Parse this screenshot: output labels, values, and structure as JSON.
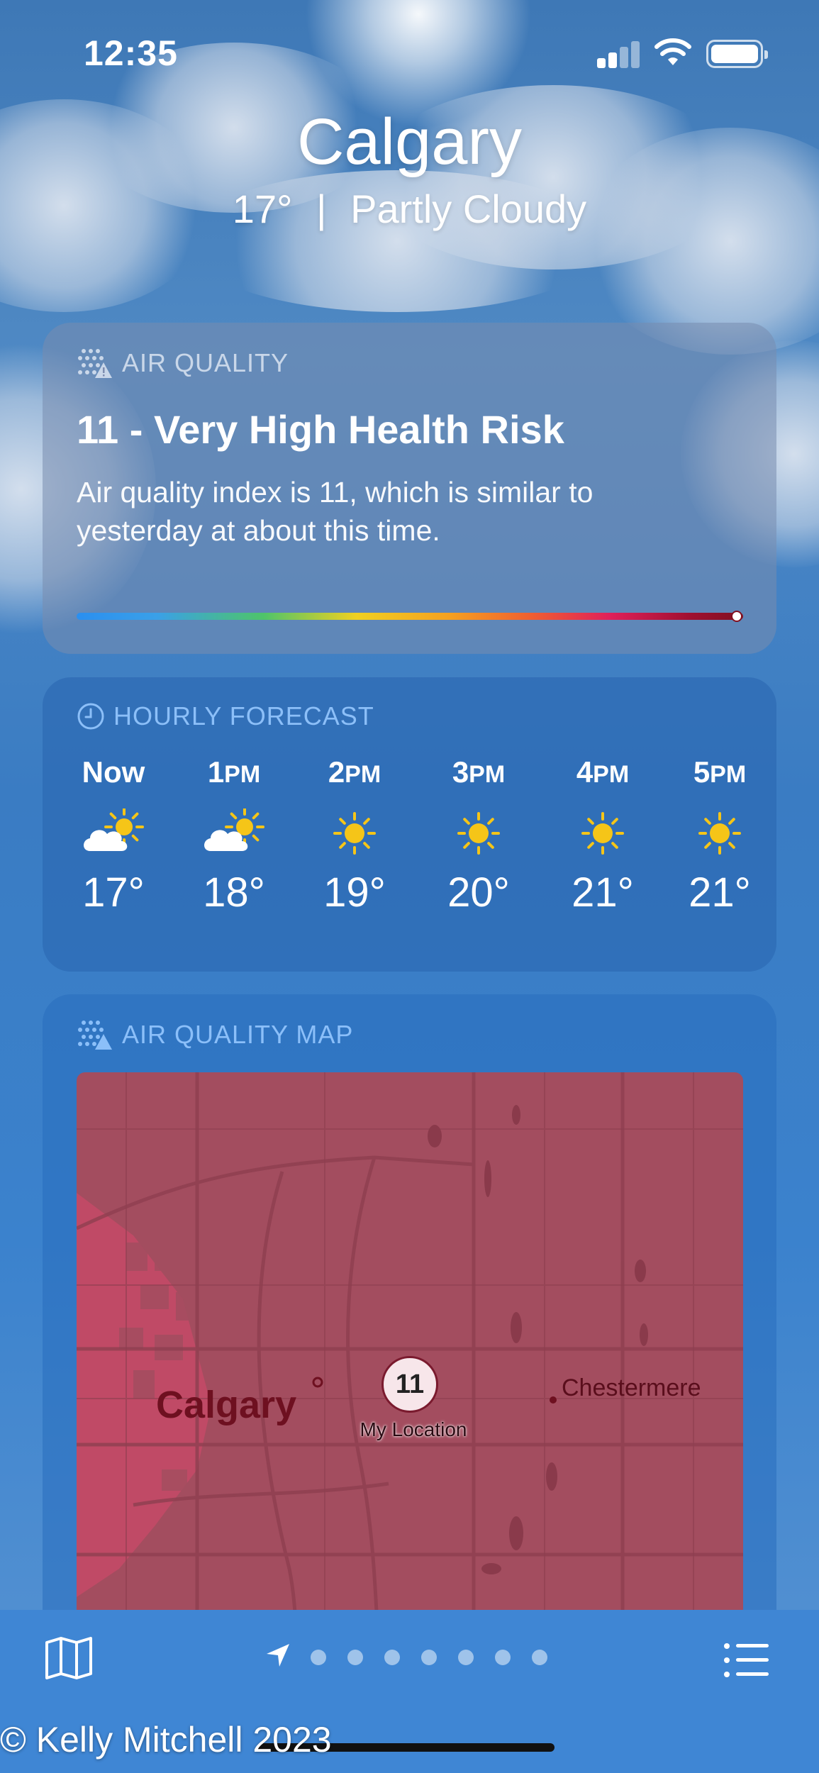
{
  "status_bar": {
    "time": "12:35"
  },
  "header": {
    "city": "Calgary",
    "temperature": "17°",
    "separator": "|",
    "condition": "Partly Cloudy"
  },
  "air_quality": {
    "section_label": "AIR QUALITY",
    "title": "11 - Very High Health Risk",
    "description": "Air quality index is 11, which is similar to yesterday at about this time.",
    "scale_level": 0.99
  },
  "hourly_forecast": {
    "section_label": "HOURLY FORECAST",
    "hours": [
      {
        "label": "Now",
        "suffix": "",
        "icon": "partly-cloudy-icon",
        "temp": "17°"
      },
      {
        "label": "1",
        "suffix": "PM",
        "icon": "partly-cloudy-icon",
        "temp": "18°"
      },
      {
        "label": "2",
        "suffix": "PM",
        "icon": "sun-icon",
        "temp": "19°"
      },
      {
        "label": "3",
        "suffix": "PM",
        "icon": "sun-icon",
        "temp": "20°"
      },
      {
        "label": "4",
        "suffix": "PM",
        "icon": "sun-icon",
        "temp": "21°"
      },
      {
        "label": "5",
        "suffix": "PM",
        "icon": "sun-icon",
        "temp": "21°"
      }
    ]
  },
  "air_quality_map": {
    "section_label": "AIR QUALITY MAP",
    "pin_value": "11",
    "pin_label": "My Location",
    "city_label": "Calgary",
    "town_label": "Chestermere"
  },
  "tab_bar": {
    "page_count": 7,
    "icons": [
      "map-icon",
      "location-arrow-icon",
      "list-icon"
    ]
  },
  "watermark": "© Kelly Mitchell 2023",
  "colors": {
    "sun": "#f5c518",
    "map_fill": "#a34d5f",
    "map_highlight": "#c04a66"
  }
}
